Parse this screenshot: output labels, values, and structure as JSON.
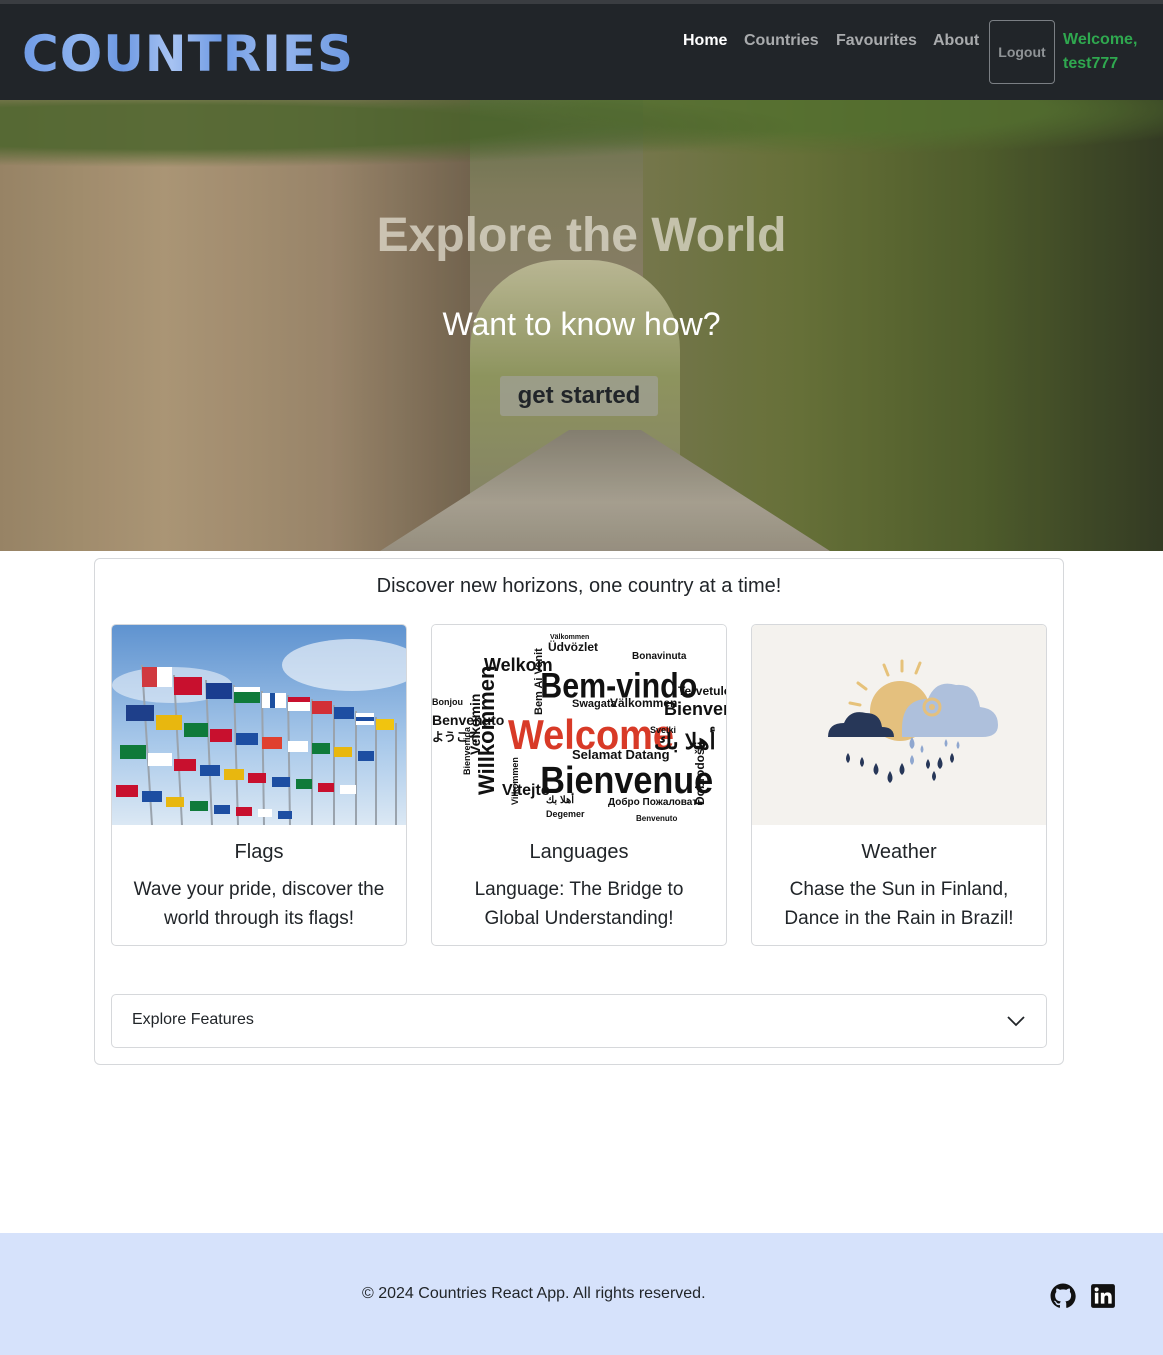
{
  "nav": {
    "brand": "COUNTRIES",
    "links": [
      "Home",
      "Countries",
      "Favourites",
      "About"
    ],
    "logout_label": "Logout",
    "welcome": "Welcome, test777"
  },
  "hero": {
    "title": "Explore the World",
    "subtitle": "Want to know how?",
    "cta_label": "get started"
  },
  "main": {
    "tagline": "Discover new horizons, one country at a time!",
    "features": [
      {
        "title": "Flags",
        "description": "Wave your pride, discover the world through its flags!"
      },
      {
        "title": "Languages",
        "description": "Language: The Bridge to Global Understanding!"
      },
      {
        "title": "Weather",
        "description": "Chase the Sun in Finland, Dance in the Rain in Brazil!"
      }
    ],
    "languages_image_words": [
      "Welcome",
      "Bem-vindo",
      "Bienvenue",
      "Willkommen",
      "Välkommen",
      "Welkom",
      "Vitejte",
      "Velkomin",
      "Swagata",
      "Selamat Datang",
      "Tervetuloa",
      "Üdvözlet",
      "Bonavinuta",
      "Добро Пожаловать",
      "Degemer",
      "أهلا بك",
      "ようこそ",
      "Bienvenido",
      "Sveiki",
      "Dobrodošli",
      "Bienvenida",
      "Vilkommen",
      "Bem Ai Venit",
      "Bonjou",
      "Benvenuto"
    ],
    "accordion_label": "Explore Features"
  },
  "footer": {
    "copyright": "© 2024 Countries React App. All rights reserved.",
    "icons": [
      "github-icon",
      "linkedin-icon"
    ]
  },
  "colors": {
    "navbar_bg": "#212529",
    "welcome_text": "#2fa84f",
    "footer_bg": "#d6e2fb",
    "brand_text": "#7aa6e8"
  }
}
